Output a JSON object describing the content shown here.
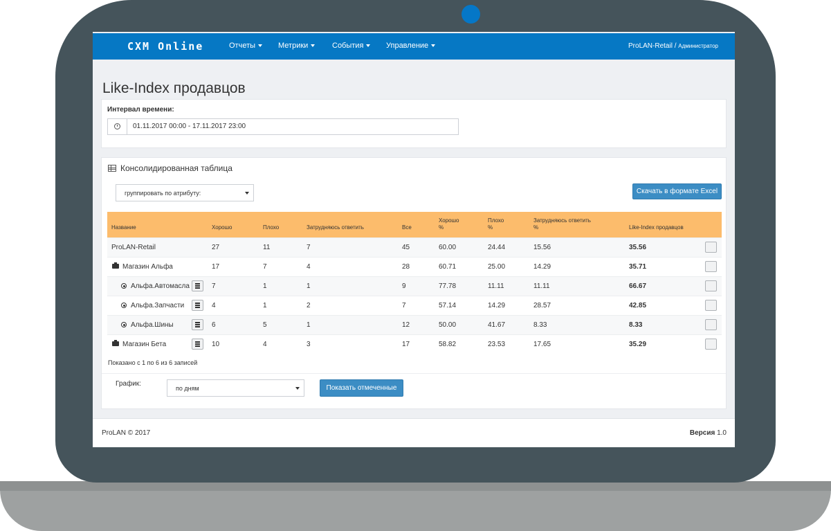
{
  "navbar": {
    "logo": "CXM Online",
    "menu": [
      {
        "label": "Отчеты"
      },
      {
        "label": "Метрики"
      },
      {
        "label": "События"
      },
      {
        "label": "Управление"
      }
    ],
    "company": "ProLAN-Retail",
    "separator": "/",
    "role": "Администратор"
  },
  "page": {
    "title": "Like-Index продавцов"
  },
  "interval": {
    "label": "Интервал времени:",
    "value": "01.11.2017 00:00 - 17.11.2017 23:00",
    "icon": "clock-icon"
  },
  "table_panel": {
    "heading": "Консолидированная таблица",
    "icon": "table-icon",
    "group_select": "группировать по атрибуту:",
    "excel_button": "Скачать в формате Excel",
    "columns": [
      {
        "l1": "Название",
        "l2": ""
      },
      {
        "l1": "Хорошо",
        "l2": ""
      },
      {
        "l1": "Плохо",
        "l2": ""
      },
      {
        "l1": "Затрудняюсь ответить",
        "l2": ""
      },
      {
        "l1": "Все",
        "l2": ""
      },
      {
        "l1": "Хорошо",
        "l2": "%"
      },
      {
        "l1": "Плохо",
        "l2": "%"
      },
      {
        "l1": "Затрудняюсь ответить",
        "l2": "%"
      },
      {
        "l1": "Like-Index продавцов",
        "l2": ""
      }
    ],
    "rows": [
      {
        "name": "ProLAN-Retail",
        "icon": "",
        "good": "27",
        "bad": "11",
        "unsure": "7",
        "all": "45",
        "good_pct": "60.00",
        "bad_pct": "24.44",
        "unsure_pct": "15.56",
        "like_index": "35.56"
      },
      {
        "name": "Магазин Альфа",
        "icon": "briefcase-icon",
        "good": "17",
        "bad": "7",
        "unsure": "4",
        "all": "28",
        "good_pct": "60.71",
        "bad_pct": "25.00",
        "unsure_pct": "14.29",
        "like_index": "35.71"
      },
      {
        "name": "Альфа.Автомасла",
        "icon": "radio-icon",
        "good": "7",
        "bad": "1",
        "unsure": "1",
        "all": "9",
        "good_pct": "77.78",
        "bad_pct": "11.11",
        "unsure_pct": "11.11",
        "like_index": "66.67"
      },
      {
        "name": "Альфа.Запчасти",
        "icon": "radio-icon",
        "good": "4",
        "bad": "1",
        "unsure": "2",
        "all": "7",
        "good_pct": "57.14",
        "bad_pct": "14.29",
        "unsure_pct": "28.57",
        "like_index": "42.85"
      },
      {
        "name": "Альфа.Шины",
        "icon": "radio-icon",
        "good": "6",
        "bad": "5",
        "unsure": "1",
        "all": "12",
        "good_pct": "50.00",
        "bad_pct": "41.67",
        "unsure_pct": "8.33",
        "like_index": "8.33"
      },
      {
        "name": "Магазин Бета",
        "icon": "briefcase-icon",
        "good": "10",
        "bad": "4",
        "unsure": "3",
        "all": "17",
        "good_pct": "58.82",
        "bad_pct": "23.53",
        "unsure_pct": "17.65",
        "like_index": "35.29"
      }
    ],
    "records_info": "Показано с 1 по 6 из 6 записей",
    "chart_label": "График:",
    "chart_select": "по дням",
    "show_button": "Показать отмеченные"
  },
  "footer": {
    "copyright": "ProLAN © 2017",
    "version_label": "Версия",
    "version_value": "1.0"
  },
  "colors": {
    "navbar": "#0678c4",
    "table_header": "#fcbc6c",
    "button": "#3c8dc4",
    "laptop_frame": "#45545b",
    "camera": "#0577c7"
  }
}
